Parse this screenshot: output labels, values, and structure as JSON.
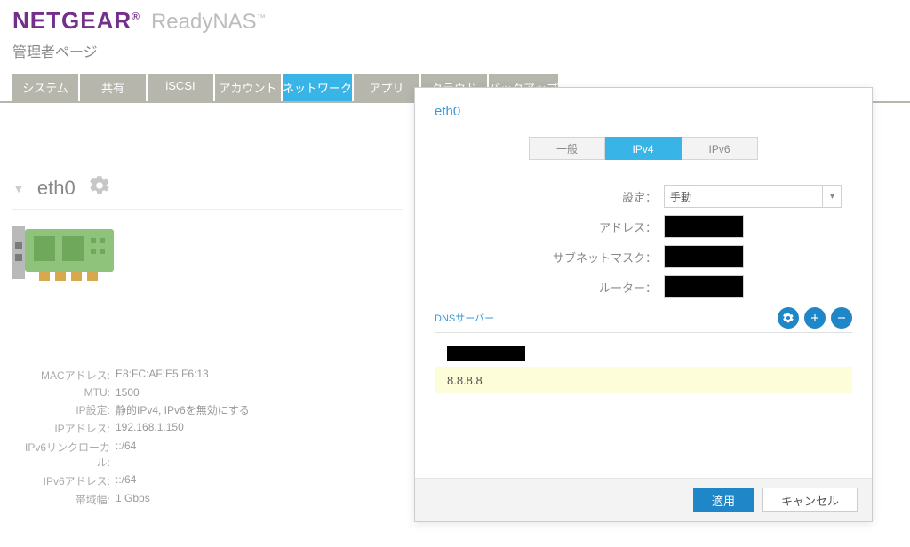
{
  "brand": {
    "netgear": "NETGEAR",
    "product": "ReadyNAS"
  },
  "subtitle": "管理者ページ",
  "nav": [
    "システム",
    "共有",
    "iSCSI",
    "アカウント",
    "ネットワーク",
    "アプリ",
    "クラウド",
    "バックアップ"
  ],
  "nav_active_index": 4,
  "left": {
    "iface": "eth0",
    "details": {
      "mac_label": "MACアドレス:",
      "mac": "E8:FC:AF:E5:F6:13",
      "mtu_label": "MTU:",
      "mtu": "1500",
      "ipcfg_label": "IP設定:",
      "ipcfg": "静的IPv4, IPv6を無効にする",
      "ip_label": "IPアドレス:",
      "ip": "192.168.1.150",
      "ll_label": "IPv6リンクローカル:",
      "ll": "::/64",
      "v6_label": "IPv6アドレス:",
      "v6": "::/64",
      "bw_label": "帯域幅:",
      "bw": "1 Gbps"
    }
  },
  "dialog": {
    "title": "eth0",
    "tabs": [
      "一般",
      "IPv4",
      "IPv6"
    ],
    "tabs_active_index": 1,
    "form": {
      "setting_label": "設定：",
      "setting_value": "手動",
      "addr_label": "アドレス：",
      "mask_label": "サブネットマスク：",
      "router_label": "ルーター："
    },
    "dns": {
      "label": "DNSサーバー",
      "items": [
        "",
        "8.8.8.8"
      ]
    },
    "buttons": {
      "apply": "適用",
      "cancel": "キャンセル"
    }
  }
}
